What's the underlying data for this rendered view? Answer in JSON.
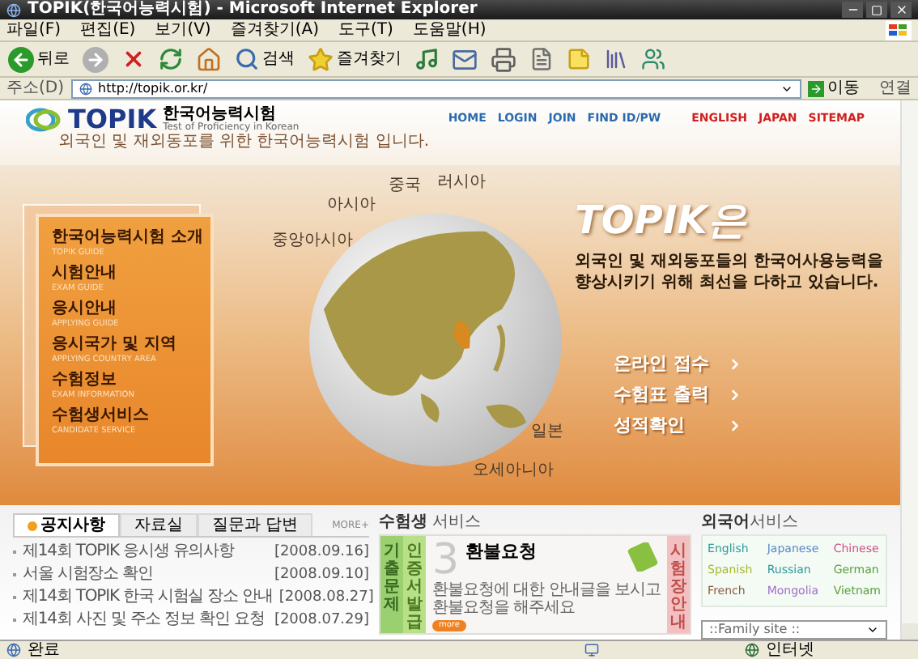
{
  "window": {
    "title": "TOPIK(한국어능력시험) - Microsoft Internet Explorer"
  },
  "menu_bar": [
    "파일(F)",
    "편집(E)",
    "보기(V)",
    "즐겨찾기(A)",
    "도구(T)",
    "도움말(H)"
  ],
  "toolbar": [
    {
      "kind": "back",
      "label": "뒤로"
    },
    {
      "kind": "forward"
    },
    {
      "kind": "stop"
    },
    {
      "kind": "refresh"
    },
    {
      "kind": "home"
    },
    {
      "kind": "search",
      "label": "검색"
    },
    {
      "kind": "favorites",
      "label": "즐겨찾기"
    },
    {
      "kind": "media"
    },
    {
      "kind": "mail"
    },
    {
      "kind": "print"
    },
    {
      "kind": "edit"
    },
    {
      "kind": "note"
    },
    {
      "kind": "research"
    },
    {
      "kind": "messenger"
    }
  ],
  "address_bar": {
    "label": "주소(D)",
    "value": "http://topik.or.kr/",
    "go": "이동",
    "links": "연결"
  },
  "site": {
    "logo": {
      "name": "TOPIK",
      "korean": "한국어능력시험",
      "english": "Test of Proficiency in Korean",
      "tagline": "외국인 및 재외동포를 위한 한국어능력시험 입니다."
    },
    "top_links": [
      {
        "label": "HOME",
        "kind": "main"
      },
      {
        "label": "LOGIN",
        "kind": "main"
      },
      {
        "label": "JOIN",
        "kind": "main"
      },
      {
        "label": "FIND ID/PW",
        "kind": "main"
      },
      {
        "label": "ENGLISH",
        "kind": "language"
      },
      {
        "label": "JAPAN",
        "kind": "language"
      },
      {
        "label": "SITEMAP",
        "kind": "language"
      }
    ],
    "side_menu": [
      {
        "title": "한국어능력시험 소개",
        "subtitle": "TOPIK GUIDE"
      },
      {
        "title": "시험안내",
        "subtitle": "EXAM GUIDE"
      },
      {
        "title": "응시안내",
        "subtitle": "APPLYING GUIDE"
      },
      {
        "title": "응시국가 및 지역",
        "subtitle": "APPLYING COUNTRY AREA"
      },
      {
        "title": "수험정보",
        "subtitle": "EXAM INFORMATION"
      },
      {
        "title": "수험생서비스",
        "subtitle": "CANDIDATE SERVICE"
      }
    ],
    "globe_labels": [
      "중앙아시아",
      "아시아",
      "중국",
      "러시아",
      "일본",
      "오세아니아"
    ],
    "intro": {
      "title": "TOPIK은",
      "lines": [
        "외국인 및 재외동포들의 한국어사용능력을",
        "향상시키기 위해 최선을 다하고 있습니다."
      ]
    },
    "quick_links": [
      "온라인 접수",
      "수험표 출력",
      "성적확인"
    ],
    "notice": {
      "tabs": [
        {
          "label": "공지사항",
          "selected": true
        },
        {
          "label": "자료실",
          "selected": false
        },
        {
          "label": "질문과 답변",
          "selected": false
        }
      ],
      "more": "MORE+",
      "items": [
        {
          "title": "제14회 TOPIK 응시생 유의사항",
          "date": "[2008.09.16]"
        },
        {
          "title": "서울 시험장소 확인",
          "date": "[2008.09.10]"
        },
        {
          "title": "제14회 TOPIK 한국 시험실 장소 안내",
          "date": "[2008.08.27]"
        },
        {
          "title": "제14회 사진 및 주소 정보 확인 요청",
          "date": "[2008.07.29]"
        }
      ]
    },
    "service": {
      "heading_bold": "수험생",
      "heading": "서비스",
      "side_tabs": [
        "기출문제",
        "인증서발급"
      ],
      "feature": {
        "number": "3",
        "title": "환불요청",
        "lines": [
          "환불요청에 대한 안내글을 보시고",
          "환불요청을 해주세요"
        ],
        "more": "more"
      },
      "right_tab": "시험장안내"
    },
    "foreign": {
      "heading_bold": "외국어",
      "heading": "서비스",
      "languages": [
        {
          "label": "English",
          "color": "#2f9a9a"
        },
        {
          "label": "Japanese",
          "color": "#5a8ac8"
        },
        {
          "label": "Chinese",
          "color": "#d0508a"
        },
        {
          "label": "Spanish",
          "color": "#a8b830"
        },
        {
          "label": "Russian",
          "color": "#2f9a9a"
        },
        {
          "label": "German",
          "color": "#5aa040"
        },
        {
          "label": "French",
          "color": "#8a6040"
        },
        {
          "label": "Mongolia",
          "color": "#a070c8"
        },
        {
          "label": "Vietnam",
          "color": "#5aa040"
        }
      ],
      "family_site": "::Family site ::"
    }
  },
  "status_bar": {
    "text": "완료",
    "zone": "인터넷"
  }
}
